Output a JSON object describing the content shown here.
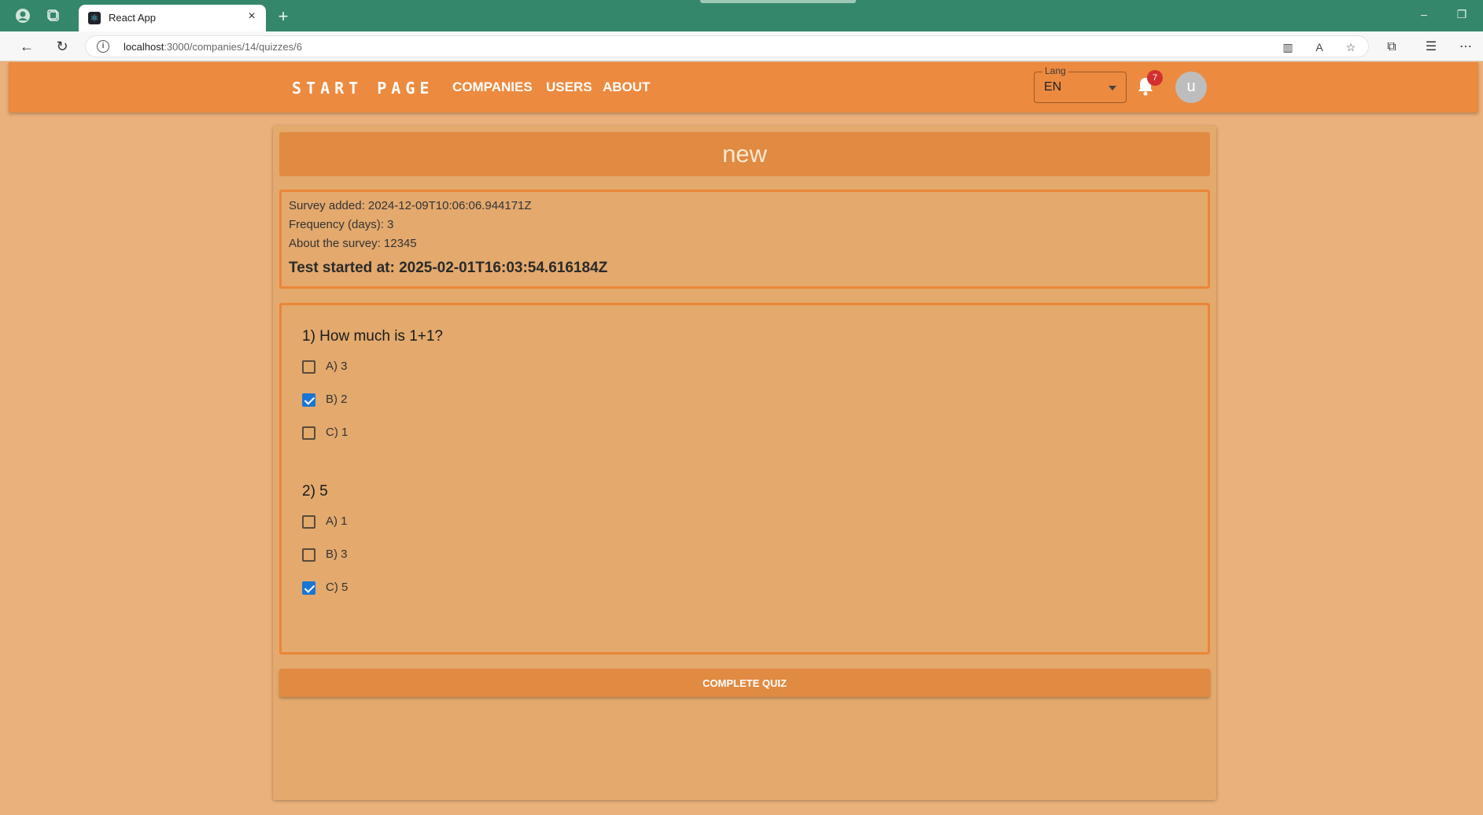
{
  "browser": {
    "tab_title": "React App",
    "new_tab_symbol": "+",
    "close_symbol": "×",
    "url_host": "localhost",
    "url_path": ":3000/companies/14/quizzes/6"
  },
  "header": {
    "brand": "START PAGE",
    "nav": [
      "COMPANIES",
      "USERS",
      "ABOUT"
    ],
    "lang_label": "Lang",
    "lang_value": "EN",
    "notification_count": "7",
    "avatar_letter": "u"
  },
  "quiz": {
    "title": "new",
    "survey_added": "Survey added: 2024-12-09T10:06:06.944171Z",
    "frequency": "Frequency (days): 3",
    "about": "About the survey: 12345",
    "started": "Test started at: 2025-02-01T16:03:54.616184Z",
    "questions": [
      {
        "title": "1) How much is 1+1?",
        "options": [
          {
            "label": "A) 3",
            "checked": false
          },
          {
            "label": "B) 2",
            "checked": true
          },
          {
            "label": "C) 1",
            "checked": false
          }
        ]
      },
      {
        "title": "2) 5",
        "options": [
          {
            "label": "A) 1",
            "checked": false
          },
          {
            "label": "B) 3",
            "checked": false
          },
          {
            "label": "C) 5",
            "checked": true
          }
        ]
      }
    ],
    "complete_label": "COMPLETE QUIZ"
  },
  "colors": {
    "titlebar": "#34876a",
    "appbar": "#ec8a3f",
    "page_bg": "#ebb17c",
    "card_bg": "#e3a96d",
    "accent_border": "#eb8537",
    "checkbox_checked": "#1976d2",
    "badge": "#d32f2f"
  }
}
